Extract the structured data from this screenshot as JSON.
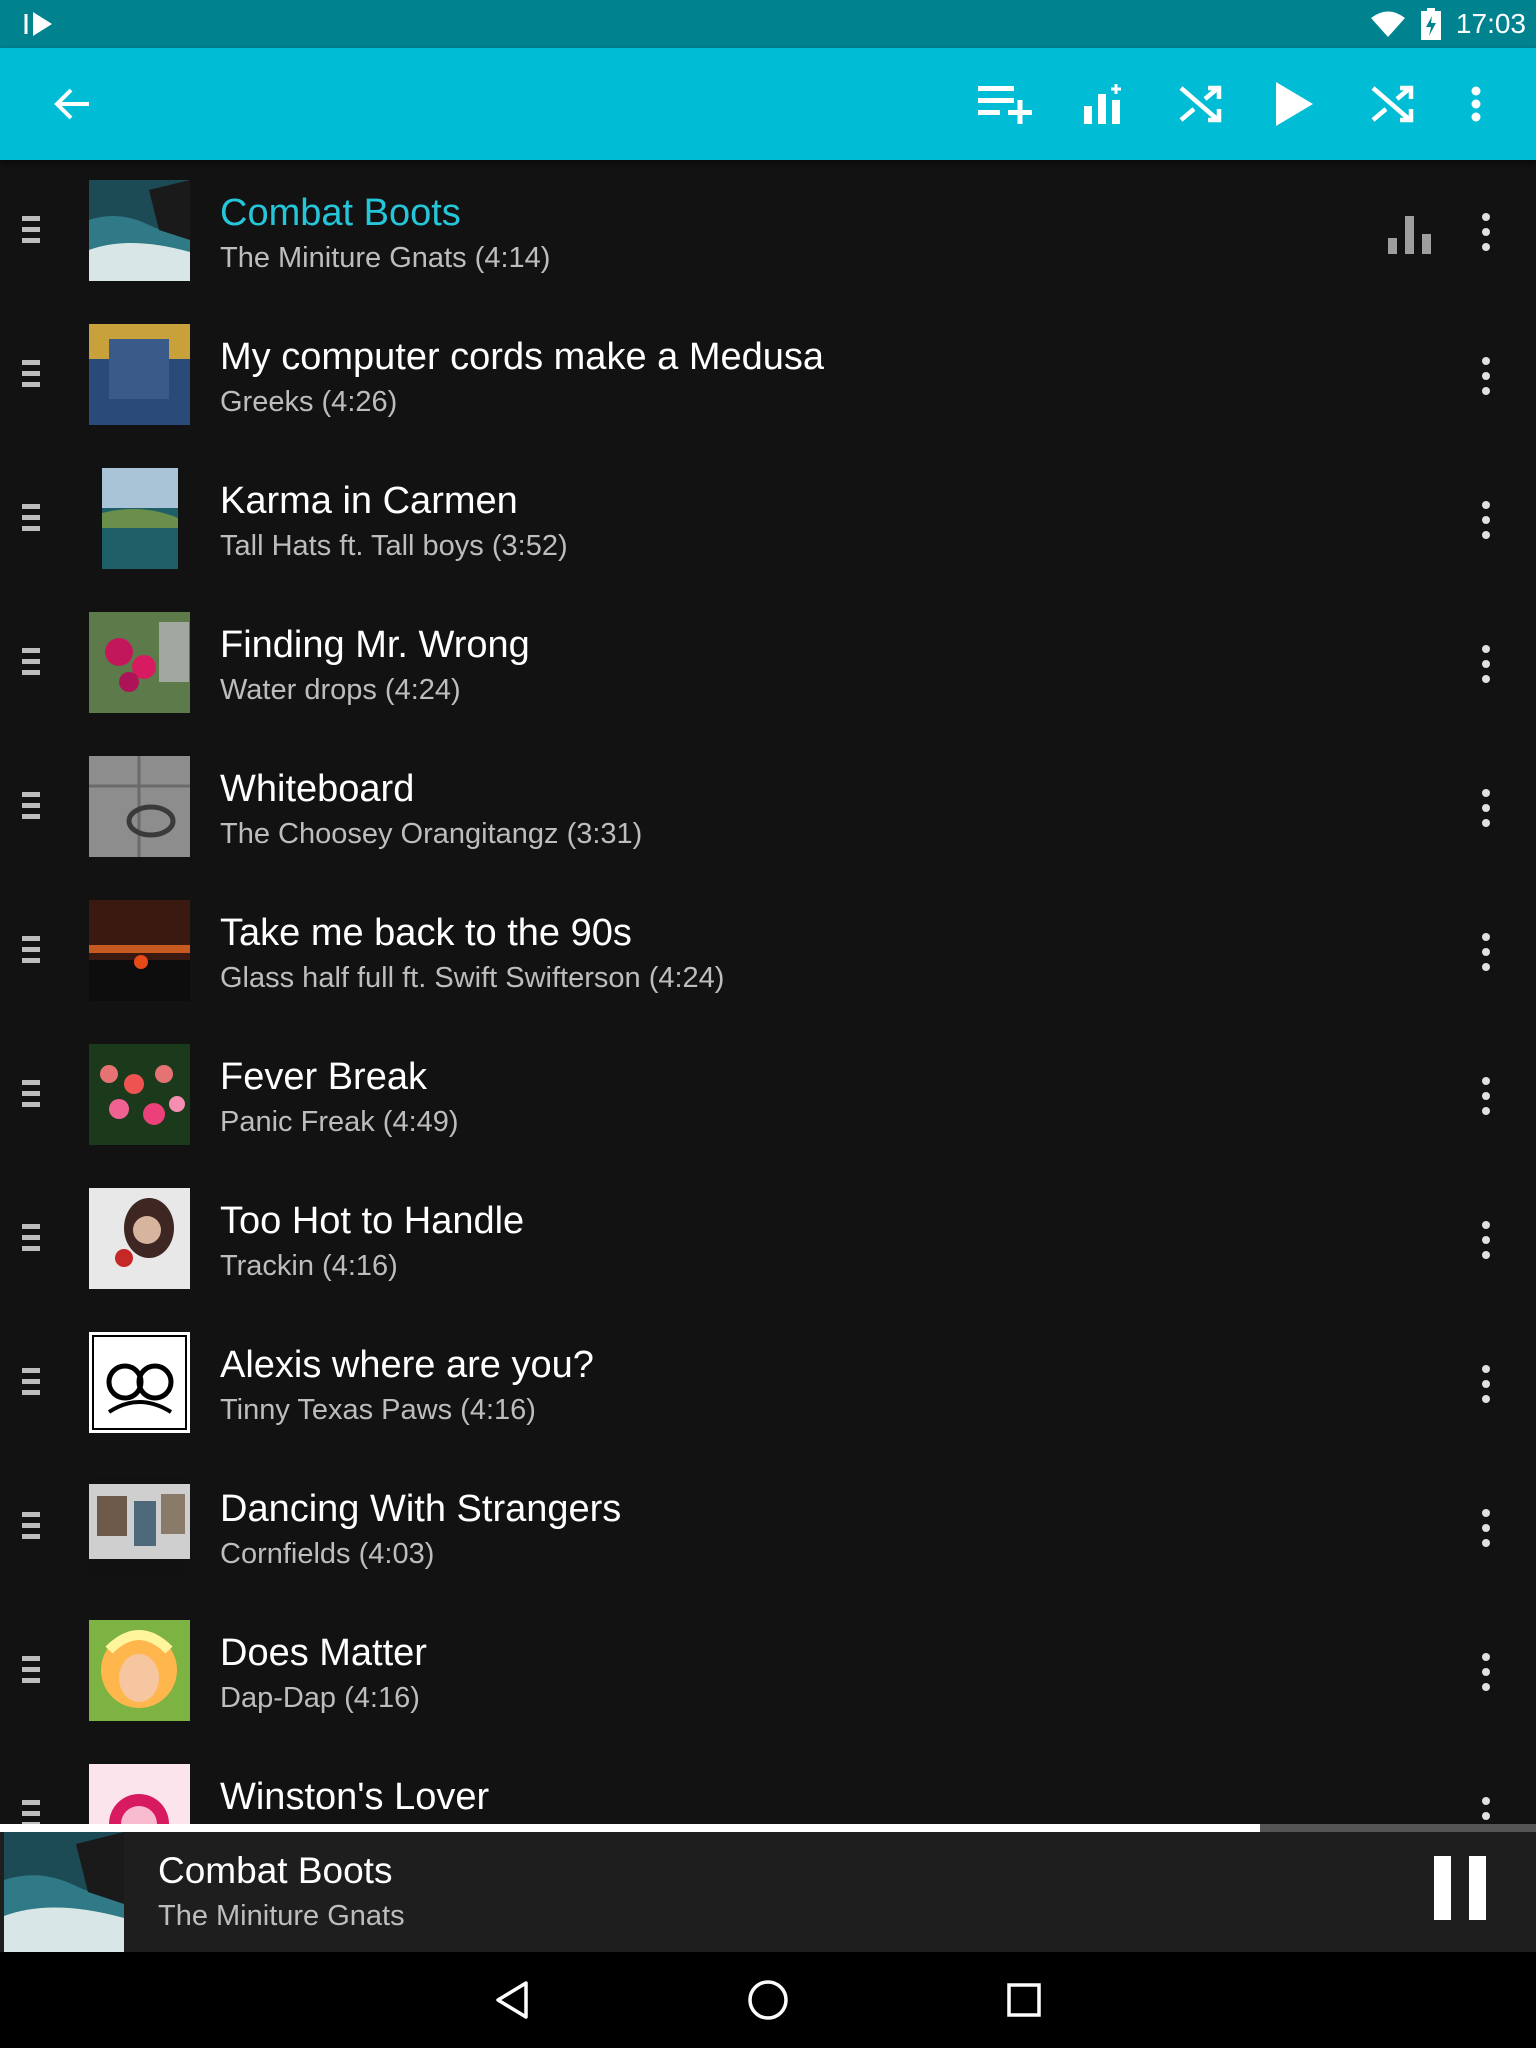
{
  "status_bar": {
    "time": "17:03",
    "icons": [
      "app-notification-icon",
      "wifi-icon",
      "battery-icon"
    ]
  },
  "toolbar": {
    "buttons": [
      "back-icon",
      "add-to-playlist-icon",
      "equalizer-add-icon",
      "shuffle-icon",
      "play-icon",
      "shuffle-all-icon",
      "overflow-menu-icon"
    ],
    "accent_color": "#00bcd4"
  },
  "tracks": [
    {
      "title": "Combat Boots",
      "subtitle": "The Miniture Gnats (4:14)",
      "playing": true
    },
    {
      "title": "My computer cords make a Medusa",
      "subtitle": "Greeks (4:26)"
    },
    {
      "title": "Karma in Carmen",
      "subtitle": "Tall Hats ft. Tall boys (3:52)"
    },
    {
      "title": "Finding Mr. Wrong",
      "subtitle": "Water drops (4:24)"
    },
    {
      "title": "Whiteboard",
      "subtitle": "The Choosey Orangitangz (3:31)"
    },
    {
      "title": "Take me back to the 90s",
      "subtitle": "Glass half full ft. Swift Swifterson (4:24)"
    },
    {
      "title": "Fever Break",
      "subtitle": "Panic Freak (4:49)"
    },
    {
      "title": "Too Hot to Handle",
      "subtitle": "Trackin (4:16)"
    },
    {
      "title": "Alexis where are you?",
      "subtitle": "Tinny Texas Paws (4:16)"
    },
    {
      "title": "Dancing With Strangers",
      "subtitle": "Cornfields (4:03)"
    },
    {
      "title": "Does Matter",
      "subtitle": "Dap-Dap (4:16)"
    },
    {
      "title": "Winston's Lover",
      "subtitle": ""
    }
  ],
  "now_playing": {
    "title": "Combat Boots",
    "artist": "The Miniture Gnats",
    "progress": 0.82
  },
  "nav_bar": {
    "buttons": [
      "back-triangle-icon",
      "home-circle-icon",
      "recents-square-icon"
    ]
  }
}
